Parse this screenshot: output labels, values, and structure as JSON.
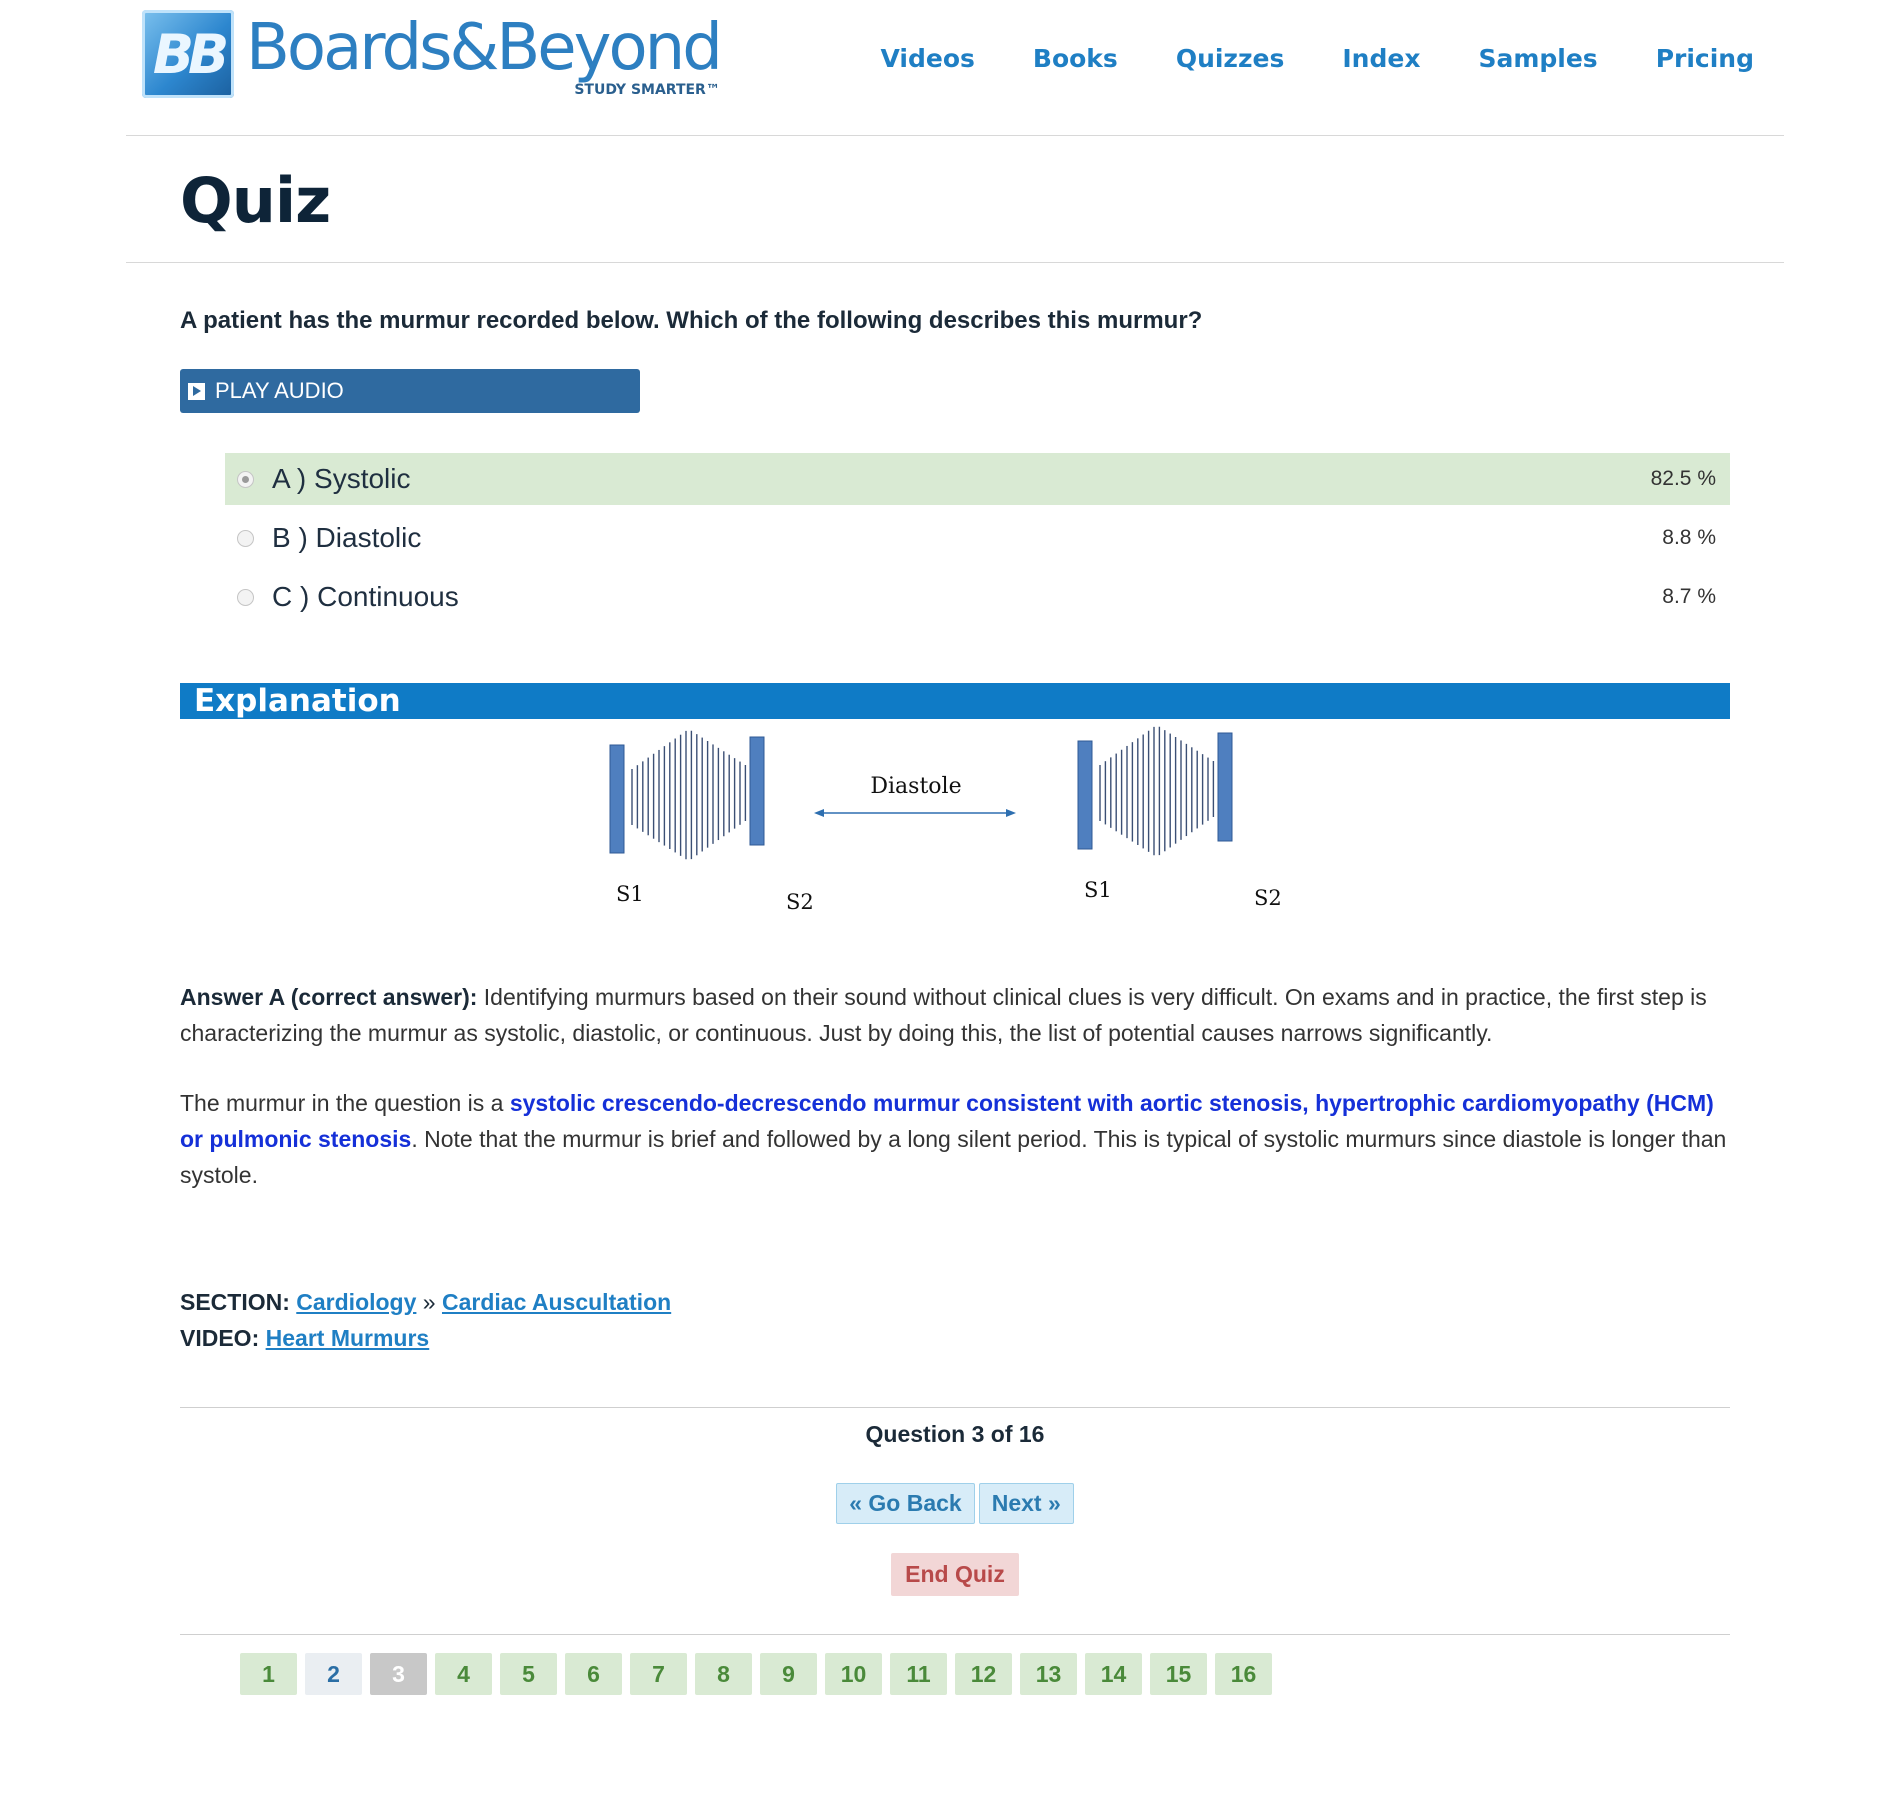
{
  "brand": {
    "badge": "BB",
    "name": "Boards&Beyond",
    "tagline": "STUDY SMARTER™"
  },
  "nav": [
    "Videos",
    "Books",
    "Quizzes",
    "Index",
    "Samples",
    "Pricing"
  ],
  "page_title": "Quiz",
  "question": "A patient has the murmur recorded below. Which of the following describes this murmur?",
  "play_audio": "PLAY AUDIO",
  "answers": [
    {
      "label": "A ) Systolic",
      "pct": "82.5 %",
      "selected": true,
      "correct": true
    },
    {
      "label": "B ) Diastolic",
      "pct": "8.8 %",
      "selected": false,
      "correct": false
    },
    {
      "label": "C ) Continuous",
      "pct": "8.7 %",
      "selected": false,
      "correct": false
    }
  ],
  "explanation_heading": "Explanation",
  "diagram": {
    "middle_label": "Diastole",
    "labels": [
      "S1",
      "S2",
      "S1",
      "S2"
    ]
  },
  "para1": {
    "lead": "Answer A (correct answer):",
    "text": " Identifying murmurs based on their sound without clinical clues is very difficult. On exams and in practice, the first step is characterizing the murmur as systolic, diastolic, or continuous. Just by doing this, the list of potential causes narrows significantly."
  },
  "para2": {
    "pre": "The murmur in the question is a ",
    "highlight": "systolic crescendo-decrescendo murmur consistent with aortic stenosis, hypertrophic cardiomyopathy (HCM) or pulmonic stenosis",
    "post": ". Note that the murmur is brief and followed by a long silent period. This is typical of systolic murmurs since diastole is longer than systole."
  },
  "section": {
    "label": "SECTION:",
    "link1": "Cardiology",
    "sep": " » ",
    "link2": "Cardiac Auscultation"
  },
  "video": {
    "label": "VIDEO:",
    "link": "Heart Murmurs"
  },
  "question_count": "Question 3 of 16",
  "go_back": "« Go Back",
  "next": "Next »",
  "end_quiz": "End Quiz",
  "pages": [
    {
      "n": "1",
      "state": "answered"
    },
    {
      "n": "2",
      "state": "visited"
    },
    {
      "n": "3",
      "state": "current"
    },
    {
      "n": "4",
      "state": "answered"
    },
    {
      "n": "5",
      "state": "answered"
    },
    {
      "n": "6",
      "state": "answered"
    },
    {
      "n": "7",
      "state": "answered"
    },
    {
      "n": "8",
      "state": "answered"
    },
    {
      "n": "9",
      "state": "answered"
    },
    {
      "n": "10",
      "state": "answered"
    },
    {
      "n": "11",
      "state": "answered"
    },
    {
      "n": "12",
      "state": "answered"
    },
    {
      "n": "13",
      "state": "answered"
    },
    {
      "n": "14",
      "state": "answered"
    },
    {
      "n": "15",
      "state": "answered"
    },
    {
      "n": "16",
      "state": "answered"
    }
  ],
  "colors": {
    "brand_blue": "#1f7fc4",
    "explanation_bar": "#0f7bc6",
    "play_button": "#2f6aa0",
    "correct_bg": "#d9ead3",
    "highlight_text": "#1530d8",
    "end_quiz": "#b84a4a"
  }
}
